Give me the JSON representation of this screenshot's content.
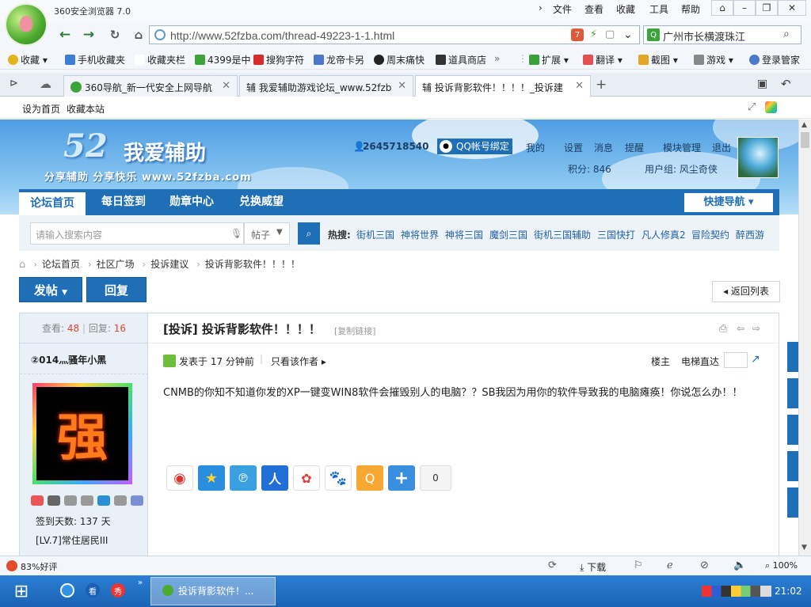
{
  "browser": {
    "title": "360安全浏览器 7.0",
    "menus": [
      "文件",
      "查看",
      "收藏",
      "工具",
      "帮助"
    ],
    "url": "http://www.52fzba.com/thread-49223-1-1.html",
    "search_text": "广州市长横渡珠江",
    "bookmarks": [
      {
        "label": "收藏",
        "color": "#e2b31c"
      },
      {
        "label": "手机收藏夹",
        "color": "#3a7fd3"
      },
      {
        "label": "收藏夹栏",
        "color": "#ffffff"
      },
      {
        "label": "4399是中",
        "color": "#3ea33a"
      },
      {
        "label": "搜狗字符",
        "color": "#d82b2b"
      },
      {
        "label": "龙帝卡另",
        "color": "#4b78c8"
      },
      {
        "label": "周末痛快",
        "color": "#222222"
      },
      {
        "label": "道具商店",
        "color": "#333333"
      }
    ],
    "bookmark_tools": [
      "扩展",
      "翻译",
      "截图",
      "游戏",
      "登录管家"
    ],
    "tabs": [
      {
        "label": "360导航_新一代安全上网导航"
      },
      {
        "label": "辅 我爱辅助游戏论坛_www.52fzb"
      },
      {
        "label": "辅 投诉背影软件！！！！_投诉建"
      }
    ],
    "subbar_links": [
      "设为首页",
      "收藏本站"
    ],
    "status_rating": "83%好评",
    "status_download": "下载",
    "status_zoom": "100%"
  },
  "site": {
    "brand_num": "52",
    "brand_name": "我爱辅助",
    "slogan": "分享辅助  分享快乐  www.52fzba.com",
    "user_id": "2645718540",
    "qq_bind": "QQ帐号绑定",
    "user_links": [
      "我的",
      "设置",
      "消息",
      "提醒",
      "模块管理",
      "退出"
    ],
    "points": "积分: 846",
    "usergroup": "用户组: 风尘奇侠",
    "nav_tabs": [
      "论坛首页",
      "每日签到",
      "勋章中心",
      "兑换威望"
    ],
    "quick_nav": "快捷导航",
    "search_placeholder": "请输入搜索内容",
    "search_type": "帖子",
    "hot_label": "热搜:",
    "hot_terms": [
      "街机三国",
      "神将世界",
      "神将三国",
      "魔剑三国",
      "街机三国辅助",
      "三国快打",
      "凡人修真2",
      "冒险契约",
      "醉西游"
    ],
    "breadcrumb": [
      "论坛首页",
      "社区广场",
      "投诉建议",
      "投诉背影软件！！！！"
    ],
    "post_button": "发帖",
    "reply_button": "回复",
    "back_list": "返回列表"
  },
  "post": {
    "views_label": "查看:",
    "views": "48",
    "replies_label": "回复:",
    "replies": "16",
    "author": "②014灬骚年小黑",
    "title": "[投诉] 投诉背影软件！！！！",
    "copy_link": "[复制链接]",
    "posted": "发表于 17 分钟前",
    "only_author": "只看该作者",
    "floor": "楼主",
    "elevator": "电梯直达",
    "content": "CNMB的你知不知道你发的XP一键变WIN8软件会摧毁别人的电脑？？SB我因为用你的软件导致我的电脑瘫痪！你说怎么办！！",
    "sign_days": "签到天数: 137 天",
    "level": "[LV.7]常住居民III",
    "share_count": "0"
  },
  "taskbar": {
    "active_item": "投诉背影软件！...",
    "time": "21:02"
  }
}
